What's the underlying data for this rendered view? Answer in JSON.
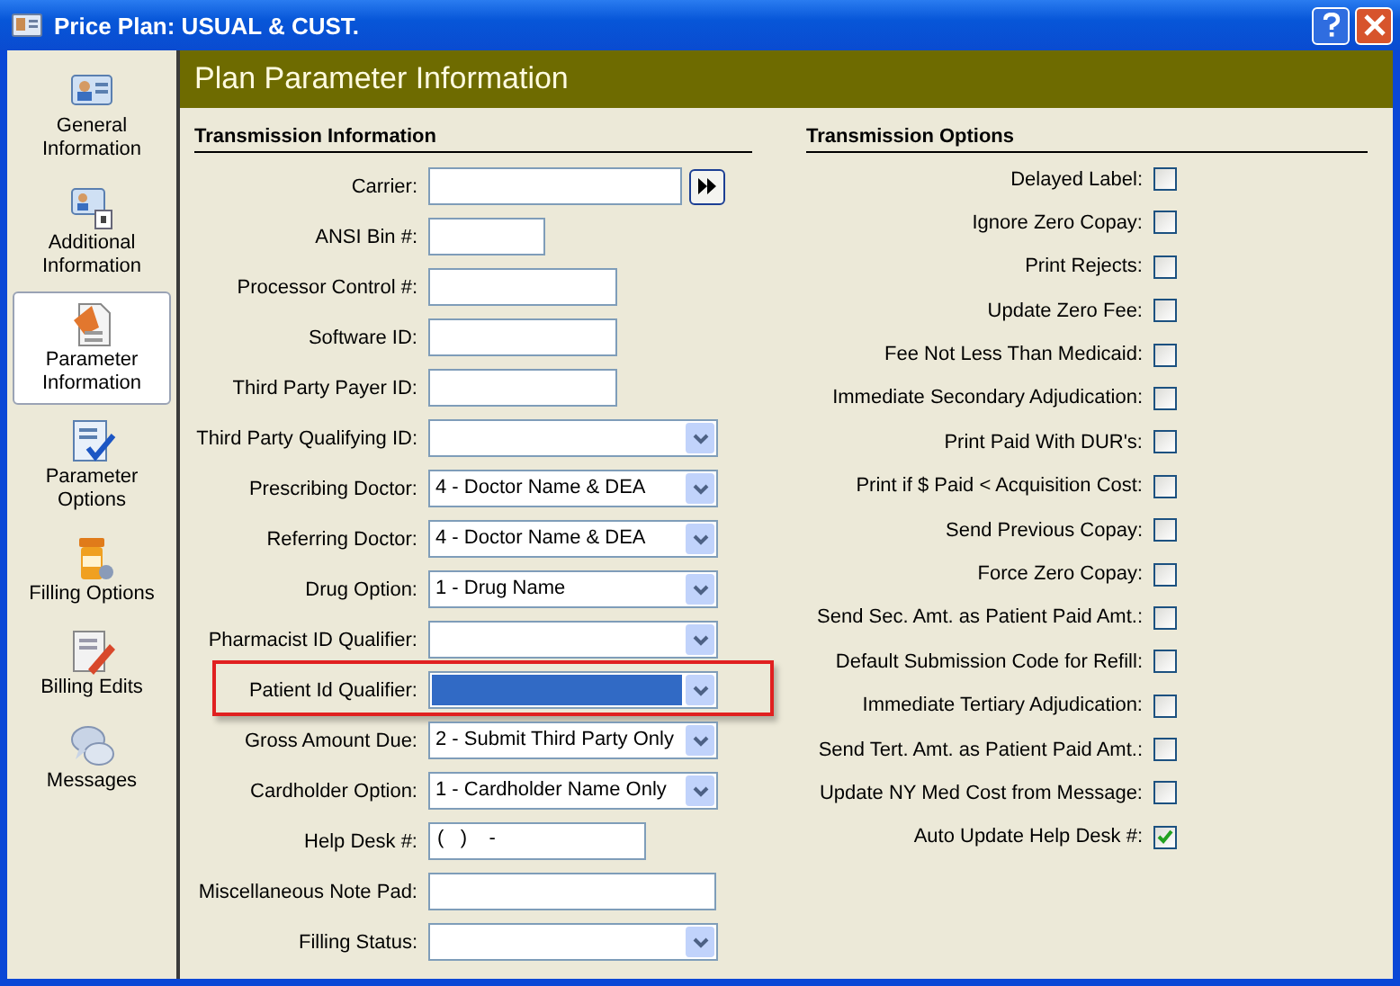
{
  "window": {
    "title": "Price Plan: USUAL & CUST."
  },
  "sidebar": {
    "items": [
      {
        "label": "General Information",
        "selected": false
      },
      {
        "label": "Additional Information",
        "selected": false
      },
      {
        "label": "Parameter Information",
        "selected": true
      },
      {
        "label": "Parameter Options",
        "selected": false
      },
      {
        "label": "Filling Options",
        "selected": false
      },
      {
        "label": "Billing Edits",
        "selected": false
      },
      {
        "label": "Messages",
        "selected": false
      }
    ]
  },
  "header": "Plan Parameter Information",
  "transmission_information": {
    "title": "Transmission Information",
    "fields": [
      {
        "label": "Carrier:",
        "kind": "lookup"
      },
      {
        "label": "ANSI Bin #:",
        "kind": "short"
      },
      {
        "label": "Processor Control #:",
        "kind": "medium"
      },
      {
        "label": "Software ID:",
        "kind": "medium"
      },
      {
        "label": "Third Party Payer ID:",
        "kind": "medium"
      },
      {
        "label": "Third Party Qualifying ID:",
        "kind": "combo"
      },
      {
        "label": "Prescribing Doctor:",
        "kind": "combo",
        "value": "4 - Doctor Name & DEA"
      },
      {
        "label": "Referring Doctor:",
        "kind": "combo",
        "value": "4 - Doctor Name & DEA"
      },
      {
        "label": "Drug Option:",
        "kind": "combo",
        "value": "1 - Drug Name"
      },
      {
        "label": "Pharmacist ID Qualifier:",
        "kind": "combo"
      },
      {
        "label": "Patient Id Qualifier:",
        "kind": "combo",
        "focused": true,
        "highlighted": true
      },
      {
        "label": "Gross Amount Due:",
        "kind": "combo",
        "value": "2 - Submit Third Party Only"
      },
      {
        "label": "Cardholder Option:",
        "kind": "combo",
        "value": "1 - Cardholder Name Only"
      },
      {
        "label": "Help Desk #:",
        "kind": "phone",
        "value": "(   )    -"
      },
      {
        "label": "Miscellaneous Note Pad:",
        "kind": "long"
      },
      {
        "label": "Filling Status:",
        "kind": "combo"
      }
    ]
  },
  "transmission_options": {
    "title": "Transmission Options",
    "options": [
      {
        "label": "Delayed Label:",
        "checked": false
      },
      {
        "label": "Ignore Zero Copay:",
        "checked": false
      },
      {
        "label": "Print Rejects:",
        "checked": false
      },
      {
        "label": "Update Zero Fee:",
        "checked": false
      },
      {
        "label": "Fee Not Less Than Medicaid:",
        "checked": false
      },
      {
        "label": "Immediate Secondary Adjudication:",
        "checked": false
      },
      {
        "label": "Print Paid With DUR's:",
        "checked": false
      },
      {
        "label": "Print if $ Paid < Acquisition Cost:",
        "checked": false
      },
      {
        "label": "Send Previous Copay:",
        "checked": false
      },
      {
        "label": "Force Zero Copay:",
        "checked": false
      },
      {
        "label": "Send Sec. Amt. as Patient Paid Amt.:",
        "checked": false
      },
      {
        "label": "Default Submission Code for Refill:",
        "checked": false
      },
      {
        "label": "Immediate Tertiary Adjudication:",
        "checked": false
      },
      {
        "label": "Send Tert. Amt. as Patient Paid Amt.:",
        "checked": false
      },
      {
        "label": "Update NY Med Cost from Message:",
        "checked": false
      },
      {
        "label": "Auto Update Help Desk #:",
        "checked": true
      }
    ]
  }
}
